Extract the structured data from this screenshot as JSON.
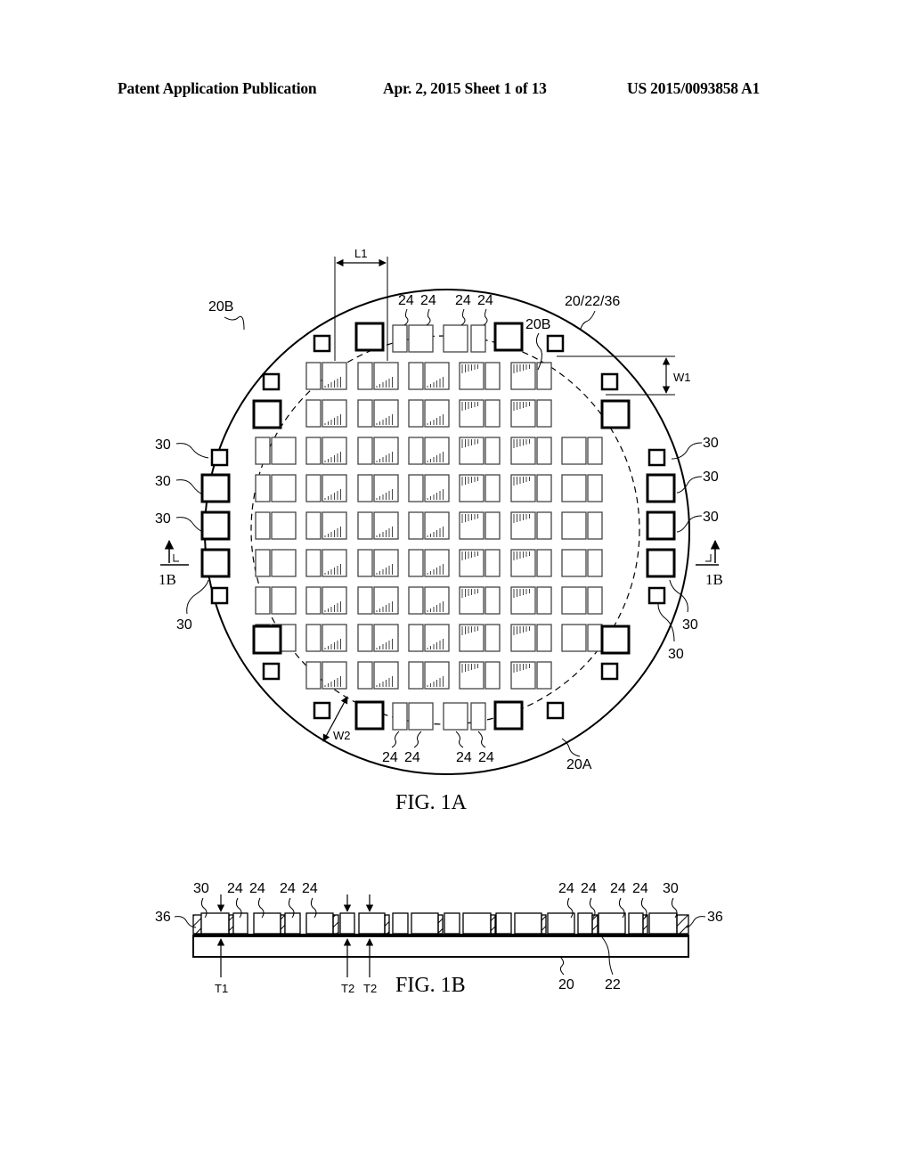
{
  "header": {
    "publication": "Patent Application Publication",
    "date_sheet": "Apr. 2, 2015   Sheet 1 of 13",
    "number": "US 2015/0093858 A1"
  },
  "fig1a": {
    "caption": "FIG. 1A",
    "labels": {
      "wafer_edge_region": "20B",
      "inner_boundary": "20B",
      "wafer_stack": "20/22/36",
      "outer_region": "20A",
      "length_dim": "L1",
      "width_dim_1": "W1",
      "width_dim_2": "W2",
      "die": "24",
      "test_pad": "30",
      "section_marker": "1B"
    },
    "die_grid": {
      "rows": 10,
      "columns_per_row": 7,
      "die_pairs": "narrow + wide die per column"
    }
  },
  "fig1b": {
    "caption": "FIG. 1B",
    "labels": {
      "left_pad": "30",
      "right_pad": "30",
      "die": "24",
      "molding_left": "36",
      "molding_right": "36",
      "substrate": "20",
      "interface_layer": "22",
      "thickness_1": "T1",
      "thickness_2a": "T2",
      "thickness_2b": "T2"
    }
  },
  "colors": {
    "ink": "#000000",
    "die_outline": "#555555",
    "paper": "#ffffff"
  }
}
